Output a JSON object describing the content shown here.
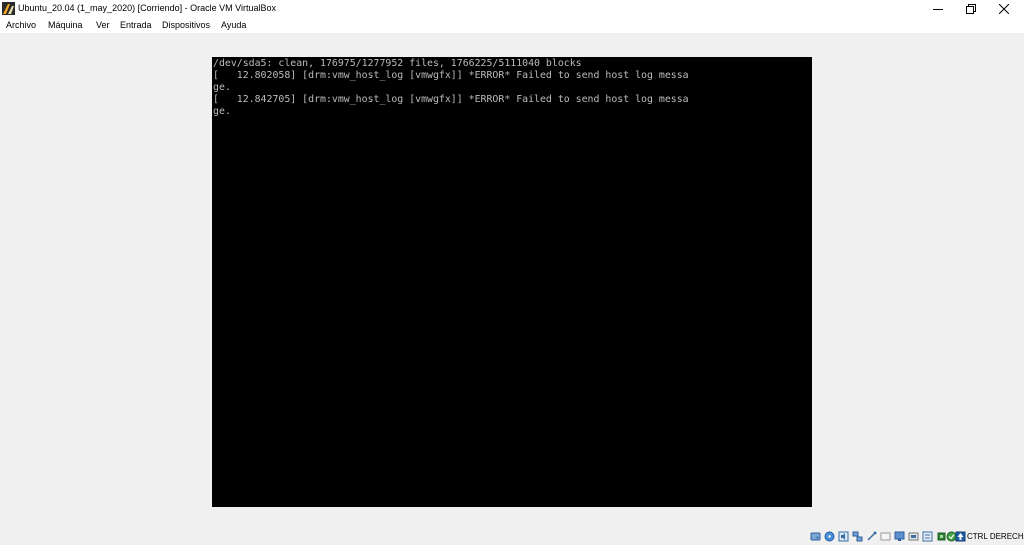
{
  "window": {
    "title": "Ubuntu_20.04 (1_may_2020) [Corriendo] - Oracle VM VirtualBox",
    "app_icon": "virtualbox-app-icon",
    "buttons": [
      "minimize-icon",
      "restore-icon",
      "close-icon"
    ]
  },
  "menu": {
    "items": [
      {
        "label": "Archivo"
      },
      {
        "label": "Máquina"
      },
      {
        "label": "Ver"
      },
      {
        "label": "Entrada"
      },
      {
        "label": "Dispositivos"
      },
      {
        "label": "Ayuda"
      }
    ]
  },
  "console": {
    "lines": [
      "/dev/sda5: clean, 176975/1277952 files, 1766225/5111040 blocks",
      "[   12.802058] [drm:vmw_host_log [vmwgfx]] *ERROR* Failed to send host log messa",
      "ge.",
      "[   12.842705] [drm:vmw_host_log [vmwgfx]] *ERROR* Failed to send host log messa",
      "ge."
    ]
  },
  "statusbar": {
    "host_key_label": "CTRL DERECHA",
    "icons": [
      "hard-disk-icon",
      "optical-drive-icon",
      "audio-icon",
      "network-icon",
      "usb-icon",
      "shared-folders-icon",
      "display-icon",
      "video-capture-icon",
      "recording-icon",
      "cpu-icon",
      "virtualization-icon",
      "mouse-integration-icon",
      "keyboard-capture-icon"
    ]
  },
  "colors": {
    "vm_screen": "#000000",
    "console_text": "#bcbcbc",
    "chrome": "#ffffff",
    "background": "#f0f0f0"
  }
}
